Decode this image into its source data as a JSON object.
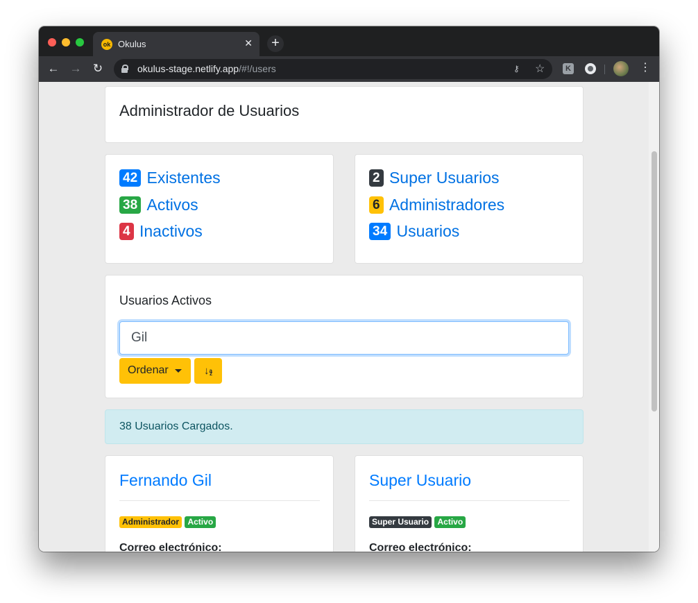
{
  "browser": {
    "tab_title": "Okulus",
    "favicon_text": "ok",
    "url_host": "okulus-stage.netlify.app",
    "url_path": "/#!/users",
    "kebab_label": "⋮",
    "ext_letter": "K"
  },
  "page": {
    "title": "Administrador de Usuarios",
    "stats_left": [
      {
        "count": "42",
        "label": "Existentes",
        "color": "#007bff"
      },
      {
        "count": "38",
        "label": "Activos",
        "color": "#28a745"
      },
      {
        "count": "4",
        "label": "Inactivos",
        "color": "#dc3545"
      }
    ],
    "stats_right": [
      {
        "count": "2",
        "label": "Super Usuarios",
        "color": "#343a40"
      },
      {
        "count": "6",
        "label": "Administradores",
        "color": "#ffc107"
      },
      {
        "count": "34",
        "label": "Usuarios",
        "color": "#007bff"
      }
    ],
    "search": {
      "heading": "Usuarios Activos",
      "value": "Gil",
      "sort_label": "Ordenar"
    },
    "alert": "38 Usuarios Cargados.",
    "users": [
      {
        "name": "Fernando Gil",
        "role": "Administrador",
        "status": "Activo",
        "email_label": "Correo electrónico:"
      },
      {
        "name": "Super Usuario",
        "role": "Super Usuario",
        "status": "Activo",
        "email_label": "Correo electrónico:"
      }
    ]
  }
}
